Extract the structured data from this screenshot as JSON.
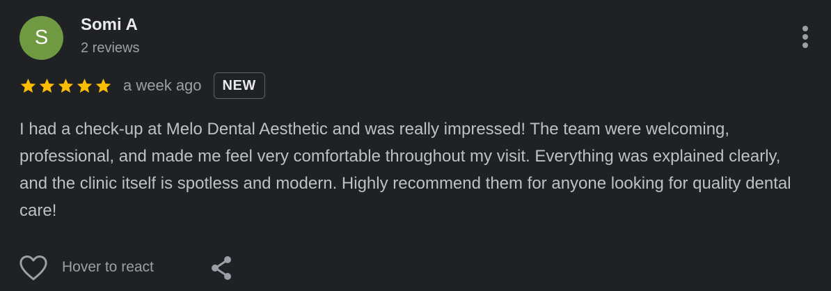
{
  "author": {
    "initial": "S",
    "name": "Somi A",
    "reviews": "2 reviews",
    "avatar_color": "#6f9a41"
  },
  "review": {
    "rating": 5,
    "max_rating": 5,
    "star_color": "#fbbc04",
    "timestamp": "a week ago",
    "badge": "NEW",
    "text": "I had a check-up at Melo Dental Aesthetic and was really impressed! The team were welcoming, professional, and made me feel very comfortable throughout my visit. Everything was explained clearly, and the clinic itself is spotless and modern. Highly recommend them for anyone looking for quality dental care!"
  },
  "actions": {
    "react_label": "Hover to react",
    "like_icon": "heart-outline-icon",
    "share_icon": "share-icon",
    "more_icon": "more-vertical-icon"
  }
}
